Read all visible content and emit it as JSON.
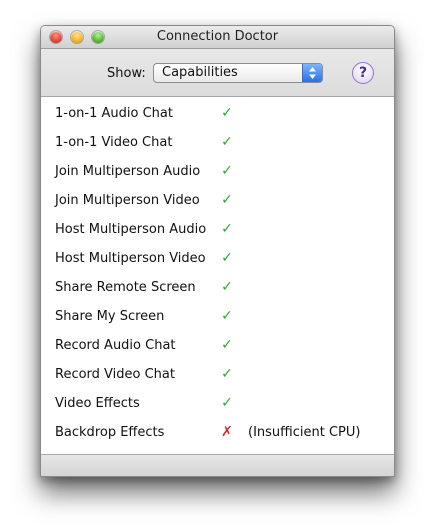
{
  "window": {
    "title": "Connection Doctor"
  },
  "toolbar": {
    "show_label": "Show:",
    "show_value": "Capabilities",
    "help_label": "?"
  },
  "colors": {
    "ok": "#2fa82f",
    "fail": "#d02c2c"
  },
  "capabilities": [
    {
      "name": "1-on-1 Audio Chat",
      "status": "✓",
      "note": ""
    },
    {
      "name": "1-on-1 Video Chat",
      "status": "✓",
      "note": ""
    },
    {
      "name": "Join Multiperson Audio",
      "status": "✓",
      "note": ""
    },
    {
      "name": "Join Multiperson Video",
      "status": "✓",
      "note": ""
    },
    {
      "name": "Host Multiperson Audio",
      "status": "✓",
      "note": ""
    },
    {
      "name": "Host Multiperson Video",
      "status": "✓",
      "note": ""
    },
    {
      "name": "Share Remote Screen",
      "status": "✓",
      "note": ""
    },
    {
      "name": "Share My Screen",
      "status": "✓",
      "note": ""
    },
    {
      "name": "Record Audio Chat",
      "status": "✓",
      "note": ""
    },
    {
      "name": "Record Video Chat",
      "status": "✓",
      "note": ""
    },
    {
      "name": "Video Effects",
      "status": "✓",
      "note": ""
    },
    {
      "name": "Backdrop Effects",
      "status": "✗",
      "note": "(Insufficient CPU)"
    }
  ]
}
